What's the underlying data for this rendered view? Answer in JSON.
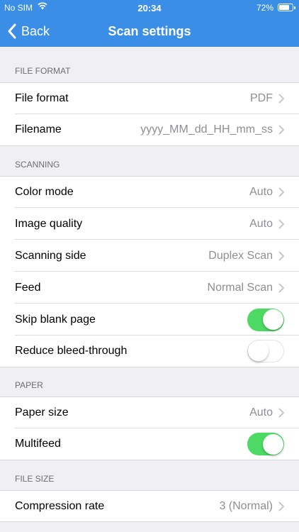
{
  "status": {
    "carrier": "No SIM",
    "time": "20:34",
    "battery": "72%"
  },
  "nav": {
    "back_label": "Back",
    "title": "Scan settings"
  },
  "sections": {
    "file_format": {
      "header": "FILE FORMAT",
      "file_format": {
        "label": "File format",
        "value": "PDF"
      },
      "filename": {
        "label": "Filename",
        "value": "yyyy_MM_dd_HH_mm_ss"
      }
    },
    "scanning": {
      "header": "SCANNING",
      "color_mode": {
        "label": "Color mode",
        "value": "Auto"
      },
      "image_quality": {
        "label": "Image quality",
        "value": "Auto"
      },
      "scanning_side": {
        "label": "Scanning side",
        "value": "Duplex Scan"
      },
      "feed": {
        "label": "Feed",
        "value": "Normal Scan"
      },
      "skip_blank": {
        "label": "Skip blank page",
        "on": true
      },
      "reduce_bleed": {
        "label": "Reduce bleed-through",
        "on": false
      }
    },
    "paper": {
      "header": "PAPER",
      "paper_size": {
        "label": "Paper size",
        "value": "Auto"
      },
      "multifeed": {
        "label": "Multifeed",
        "on": true
      }
    },
    "file_size": {
      "header": "FILE SIZE",
      "compression": {
        "label": "Compression rate",
        "value": "3 (Normal)"
      }
    }
  },
  "colors": {
    "nav_bar": "#3a8ee6",
    "toggle_on": "#4cd964",
    "background": "#efeff4"
  }
}
